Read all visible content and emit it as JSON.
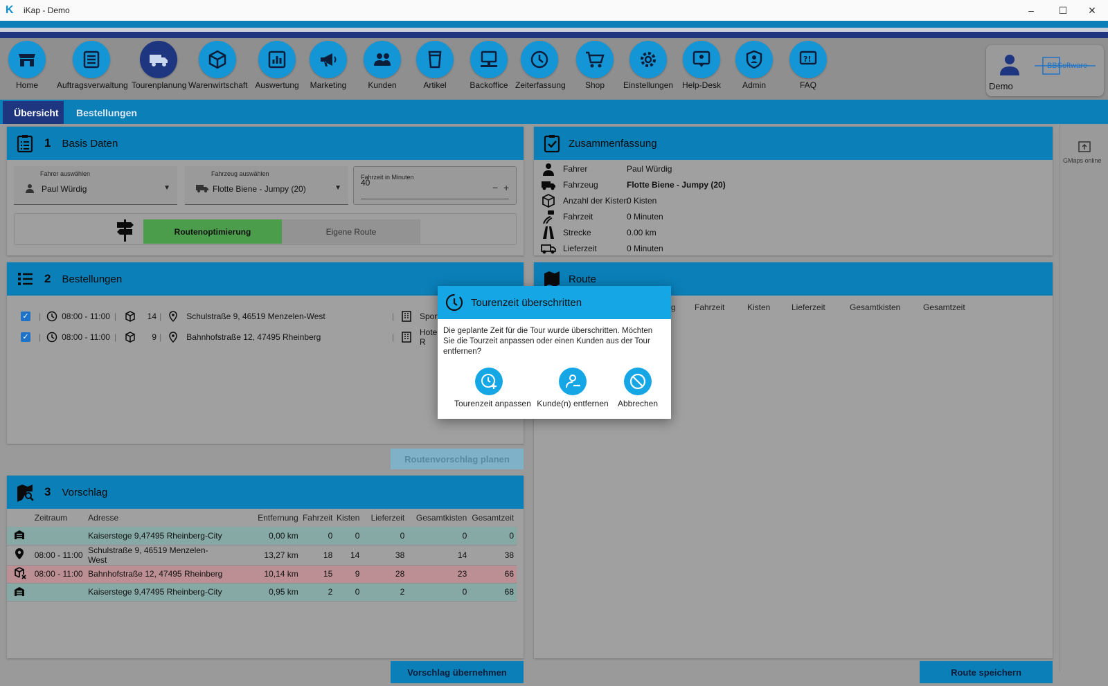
{
  "window": {
    "title": "iKap - Demo",
    "minimize": "–",
    "maximize": "☐",
    "close": "✕"
  },
  "toolbar": {
    "items": [
      {
        "label": "Home",
        "icon": "store-icon"
      },
      {
        "label": "Auftragsverwaltung",
        "icon": "list-icon"
      },
      {
        "label": "Tourenplanung",
        "icon": "truck-icon"
      },
      {
        "label": "Warenwirtschaft",
        "icon": "box-icon"
      },
      {
        "label": "Auswertung",
        "icon": "chart-icon"
      },
      {
        "label": "Marketing",
        "icon": "megaphone-icon"
      },
      {
        "label": "Kunden",
        "icon": "people-icon"
      },
      {
        "label": "Artikel",
        "icon": "cup-icon"
      },
      {
        "label": "Backoffice",
        "icon": "computer-icon"
      },
      {
        "label": "Zeiterfassung",
        "icon": "clock-icon"
      },
      {
        "label": "Shop",
        "icon": "cart-icon"
      },
      {
        "label": "Einstellungen",
        "icon": "gear-icon"
      },
      {
        "label": "Help-Desk",
        "icon": "helpdesk-icon"
      },
      {
        "label": "Admin",
        "icon": "shield-user-icon"
      },
      {
        "label": "FAQ",
        "icon": "faq-icon"
      }
    ],
    "user": "Demo",
    "brand": "BBSoftware"
  },
  "tabs": [
    {
      "label": "Übersicht"
    },
    {
      "label": "Bestellungen"
    }
  ],
  "basis": {
    "num": "1",
    "title": "Basis Daten",
    "driver_label": "Fahrer auswählen",
    "driver_value": "Paul Würdig",
    "vehicle_label": "Fahrzeug auswählen",
    "vehicle_value": "Flotte Biene - Jumpy (20)",
    "time_label": "Fahrzeit in Minuten",
    "time_value": "40",
    "minus": "−",
    "plus": "+",
    "route_opt": "Routenoptimierung",
    "own_route": "Eigene Route"
  },
  "summary": {
    "title": "Zusammenfassung",
    "rows": [
      {
        "label": "Fahrer",
        "value": "Paul Würdig"
      },
      {
        "label": "Fahrzeug",
        "value": "Flotte Biene - Jumpy (20)"
      },
      {
        "label": "Anzahl der Kisten",
        "value": "0  Kisten"
      },
      {
        "label": "Fahrzeit",
        "value": "0  Minuten"
      },
      {
        "label": "Strecke",
        "value": "0.00  km"
      },
      {
        "label": "Lieferzeit",
        "value": "0  Minuten"
      }
    ]
  },
  "orders": {
    "num": "2",
    "title": "Bestellungen",
    "rows": [
      {
        "time": "08:00 - 11:00",
        "boxes": "14",
        "address": "Schulstraße 9, 46519 Menzelen-West",
        "customer": "Sporthe"
      },
      {
        "time": "08:00 - 11:00",
        "boxes": "9",
        "address": "Bahnhofstraße 12, 47495 Rheinberg",
        "customer": "Hotel R"
      }
    ],
    "plan_button": "Routenvorschlag planen"
  },
  "route": {
    "title": "Route",
    "cols": [
      "g",
      "Fahrzeit",
      "Kisten",
      "Lieferzeit",
      "Gesamtkisten",
      "Gesamtzeit"
    ],
    "save_button": "Route speichern"
  },
  "vorschlag": {
    "num": "3",
    "title": "Vorschlag",
    "headers": [
      "Zeitraum",
      "Adresse",
      "Entfernung",
      "Fahrzeit",
      "Kisten",
      "Lieferzeit",
      "Gesamtkisten",
      "Gesamtzeit"
    ],
    "rows": [
      {
        "kind": "teal",
        "icon": "warehouse-icon",
        "time": "",
        "address": "Kaiserstege 9,47495 Rheinberg-City",
        "dist": "0,00 km",
        "drive": "0",
        "boxes": "0",
        "deliv": "0",
        "tboxes": "0",
        "ttime": "0"
      },
      {
        "kind": "plain",
        "icon": "pin-icon",
        "time": "08:00 - 11:00",
        "address": "Schulstraße 9, 46519 Menzelen-West",
        "dist": "13,27 km",
        "drive": "18",
        "boxes": "14",
        "deliv": "38",
        "tboxes": "14",
        "ttime": "38"
      },
      {
        "kind": "pink",
        "icon": "box-x-icon",
        "time": "08:00 - 11:00",
        "address": "Bahnhofstraße 12, 47495 Rheinberg",
        "dist": "10,14 km",
        "drive": "15",
        "boxes": "9",
        "deliv": "28",
        "tboxes": "23",
        "ttime": "66"
      },
      {
        "kind": "teal",
        "icon": "warehouse-icon",
        "time": "",
        "address": "Kaiserstege 9,47495 Rheinberg-City",
        "dist": "0,95 km",
        "drive": "2",
        "boxes": "0",
        "deliv": "2",
        "tboxes": "0",
        "ttime": "68"
      }
    ],
    "accept_button": "Vorschlag übernehmen"
  },
  "side": {
    "label": "GMaps online"
  },
  "dialog": {
    "title": "Tourenzeit überschritten",
    "message": "Die geplante Zeit für die Tour wurde überschritten. Möchten Sie die Tourzeit anpassen oder einen Kunden aus der Tour entfernen?",
    "actions": [
      "Tourenzeit anpassen",
      "Kunde(n) entfernen",
      "Abbrechen"
    ]
  },
  "colors": {
    "accent": "#0a7fb8",
    "dark": "#1e3580",
    "dialog_accent": "#15a6e6",
    "green": "#4b9d4b"
  }
}
